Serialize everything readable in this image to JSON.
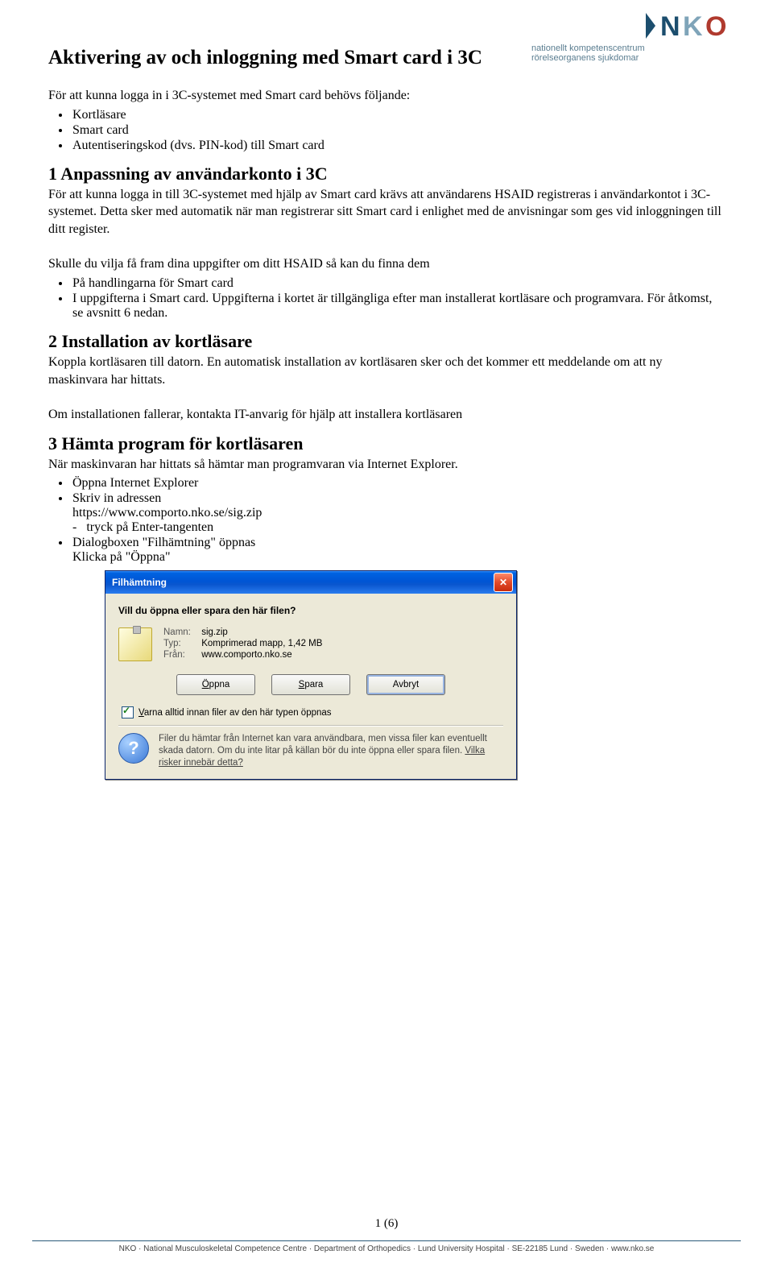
{
  "logo": {
    "big": "NKO",
    "line1": "nationellt kompetenscentrum",
    "line2": "rörelseorganens sjukdomar"
  },
  "title": "Aktivering av och inloggning med Smart card i 3C",
  "intro": "För att kunna logga in i 3C-systemet med Smart card behövs följande:",
  "introBullets": [
    "Kortläsare",
    "Smart card",
    "Autentiseringskod (dvs. PIN-kod) till Smart card"
  ],
  "sec1": {
    "heading": "1   Anpassning av användarkonto i 3C",
    "p1": "För att kunna logga in till 3C-systemet med hjälp av Smart card krävs att användarens HSAID registreras i användarkontot i 3C-systemet. Detta sker med automatik när man registrerar sitt Smart card i enlighet med de anvisningar som ges vid inloggningen till ditt register.",
    "p2": "Skulle du vilja få fram dina uppgifter om ditt  HSAID så kan du finna dem",
    "bullets": [
      "På handlingarna för Smart card",
      "I uppgifterna i Smart card. Uppgifterna i kortet är tillgängliga efter man installerat kortläsare och programvara. För åtkomst, se avsnitt 6 nedan."
    ]
  },
  "sec2": {
    "heading": "2   Installation av kortläsare",
    "p1": "Koppla kortläsaren till datorn. En automatisk installation av kortläsaren sker och det kommer ett meddelande om att ny maskinvara har hittats.",
    "p2": "Om installationen fallerar, kontakta IT-anvarig för hjälp att installera kortläsaren"
  },
  "sec3": {
    "heading": "3   Hämta program för kortläsaren",
    "p1": "När maskinvaran har hittats så hämtar man programvaran via Internet Explorer.",
    "b1": "Öppna Internet Explorer",
    "b2": "Skriv in adressen",
    "url": "https://www.comporto.nko.se/sig.zip",
    "dash": "tryck på Enter-tangenten",
    "b3": "Dialogboxen \"Filhämtning\" öppnas",
    "b3b": "Klicka på \"Öppna\""
  },
  "dialog": {
    "title": "Filhämtning",
    "question": "Vill du öppna eller spara den här filen?",
    "name_lbl": "Namn:",
    "name": "sig.zip",
    "type_lbl": "Typ:",
    "type": "Komprimerad mapp, 1,42 MB",
    "from_lbl": "Från:",
    "from": "www.comporto.nko.se",
    "btn_open": "Öppna",
    "btn_save": "Spara",
    "btn_cancel": "Avbryt",
    "check": "Varna alltid innan filer av den här typen öppnas",
    "info": "Filer du hämtar från Internet kan vara användbara, men vissa filer kan eventuellt skada datorn. Om du inte litar på källan bör du inte öppna eller spara filen.",
    "info_link": "Vilka risker innebär detta?"
  },
  "pager": "1 (6)",
  "footer": "NKO · National Musculoskeletal Competence Centre · Department of Orthopedics · Lund University Hospital · SE-22185 Lund · Sweden · www.nko.se"
}
